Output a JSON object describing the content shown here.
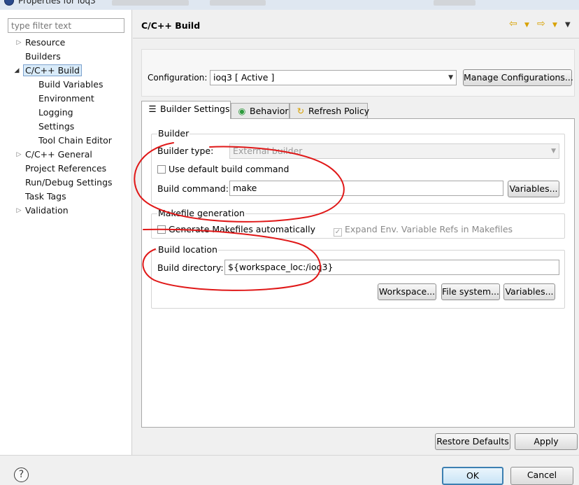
{
  "window": {
    "title": "Properties for ioq3"
  },
  "sidebar": {
    "filter_placeholder": "type filter text",
    "items": [
      {
        "label": "Resource"
      },
      {
        "label": "Builders"
      },
      {
        "label": "C/C++ Build"
      },
      {
        "label": "Build Variables"
      },
      {
        "label": "Environment"
      },
      {
        "label": "Logging"
      },
      {
        "label": "Settings"
      },
      {
        "label": "Tool Chain Editor"
      },
      {
        "label": "C/C++ General"
      },
      {
        "label": "Project References"
      },
      {
        "label": "Run/Debug Settings"
      },
      {
        "label": "Task Tags"
      },
      {
        "label": "Validation"
      }
    ]
  },
  "page": {
    "title": "C/C++ Build"
  },
  "configuration": {
    "label": "Configuration:",
    "value": "ioq3  [ Active ]",
    "manage_button": "Manage Configurations..."
  },
  "tabs": [
    {
      "label": "Builder Settings",
      "icon": "list-icon"
    },
    {
      "label": "Behavior",
      "icon": "radio-icon"
    },
    {
      "label": "Refresh Policy",
      "icon": "refresh-icon"
    }
  ],
  "builder": {
    "group_title": "Builder",
    "type_label": "Builder type:",
    "type_value": "External builder",
    "use_default_label": "Use default build command",
    "command_label": "Build command:",
    "command_value": "make",
    "variables_button": "Variables..."
  },
  "makefile": {
    "group_title": "Makefile generation",
    "generate_label": "Generate Makefiles automatically",
    "expand_label": "Expand Env. Variable Refs in Makefiles"
  },
  "location": {
    "group_title": "Build location",
    "dir_label": "Build directory:",
    "dir_value": "${workspace_loc:/ioq3}",
    "workspace_button": "Workspace...",
    "filesystem_button": "File system...",
    "variables_button": "Variables..."
  },
  "footer": {
    "restore_defaults": "Restore Defaults",
    "apply": "Apply",
    "ok": "OK",
    "cancel": "Cancel",
    "help": "?"
  },
  "colors": {
    "annotation": "#e01818",
    "selection": "#d9ebf9",
    "default_button_border": "#3c7fb1"
  }
}
